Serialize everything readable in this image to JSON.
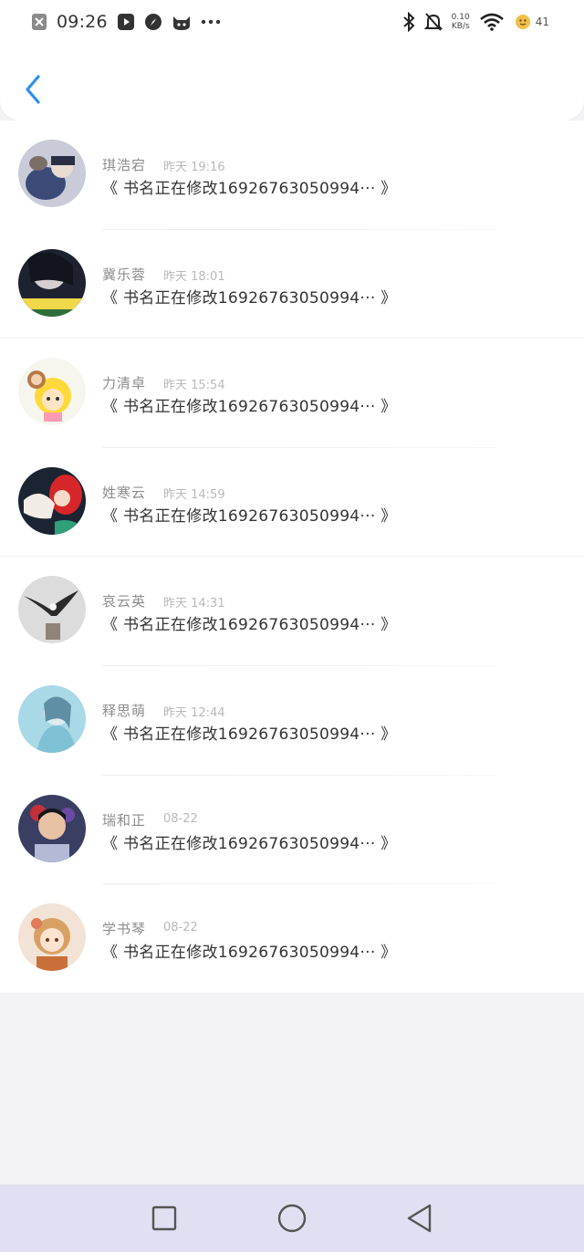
{
  "status_bar": {
    "time": "09:26",
    "net_speed": "0.10",
    "net_unit": "KB/s",
    "battery": "41",
    "icons": [
      "close-box-icon",
      "media-icon",
      "compass-icon",
      "cat-icon",
      "more-icon",
      "bluetooth-icon",
      "mute-icon",
      "wifi-icon",
      "battery-icon"
    ]
  },
  "header": {
    "back_icon": "chevron-left-icon",
    "accent_color": "#2b8ef0"
  },
  "records": [
    {
      "name": "琪浩宕",
      "time": "昨天 19:16",
      "book": "《 书名正在修改16926763050994··· 》",
      "avatar": "photo-dark-blue"
    },
    {
      "name": "冀乐蓉",
      "time": "昨天 18:01",
      "book": "《 书名正在修改16926763050994··· 》",
      "avatar": "photo-girl-dark"
    },
    {
      "name": "力清卓",
      "time": "昨天 15:54",
      "book": "《 书名正在修改16926763050994··· 》",
      "avatar": "cartoon-yellow"
    },
    {
      "name": "姓寒云",
      "time": "昨天 14:59",
      "book": "《 书名正在修改16926763050994··· 》",
      "avatar": "cartoon-mermaid"
    },
    {
      "name": "哀云英",
      "time": "昨天 14:31",
      "book": "《 书名正在修改16926763050994··· 》",
      "avatar": "eagle"
    },
    {
      "name": "释思萌",
      "time": "昨天 12:44",
      "book": "《 书名正在修改16926763050994··· 》",
      "avatar": "photo-light-blue"
    },
    {
      "name": "瑞和正",
      "time": "08-22",
      "book": "《 书名正在修改16926763050994··· 》",
      "avatar": "photo-boy"
    },
    {
      "name": "学书琴",
      "time": "08-22",
      "book": "《 书名正在修改16926763050994··· 》",
      "avatar": "cartoon-girl-orange"
    }
  ],
  "nav_bar": {
    "icons": [
      "recents-square-icon",
      "home-circle-icon",
      "back-triangle-icon"
    ]
  }
}
